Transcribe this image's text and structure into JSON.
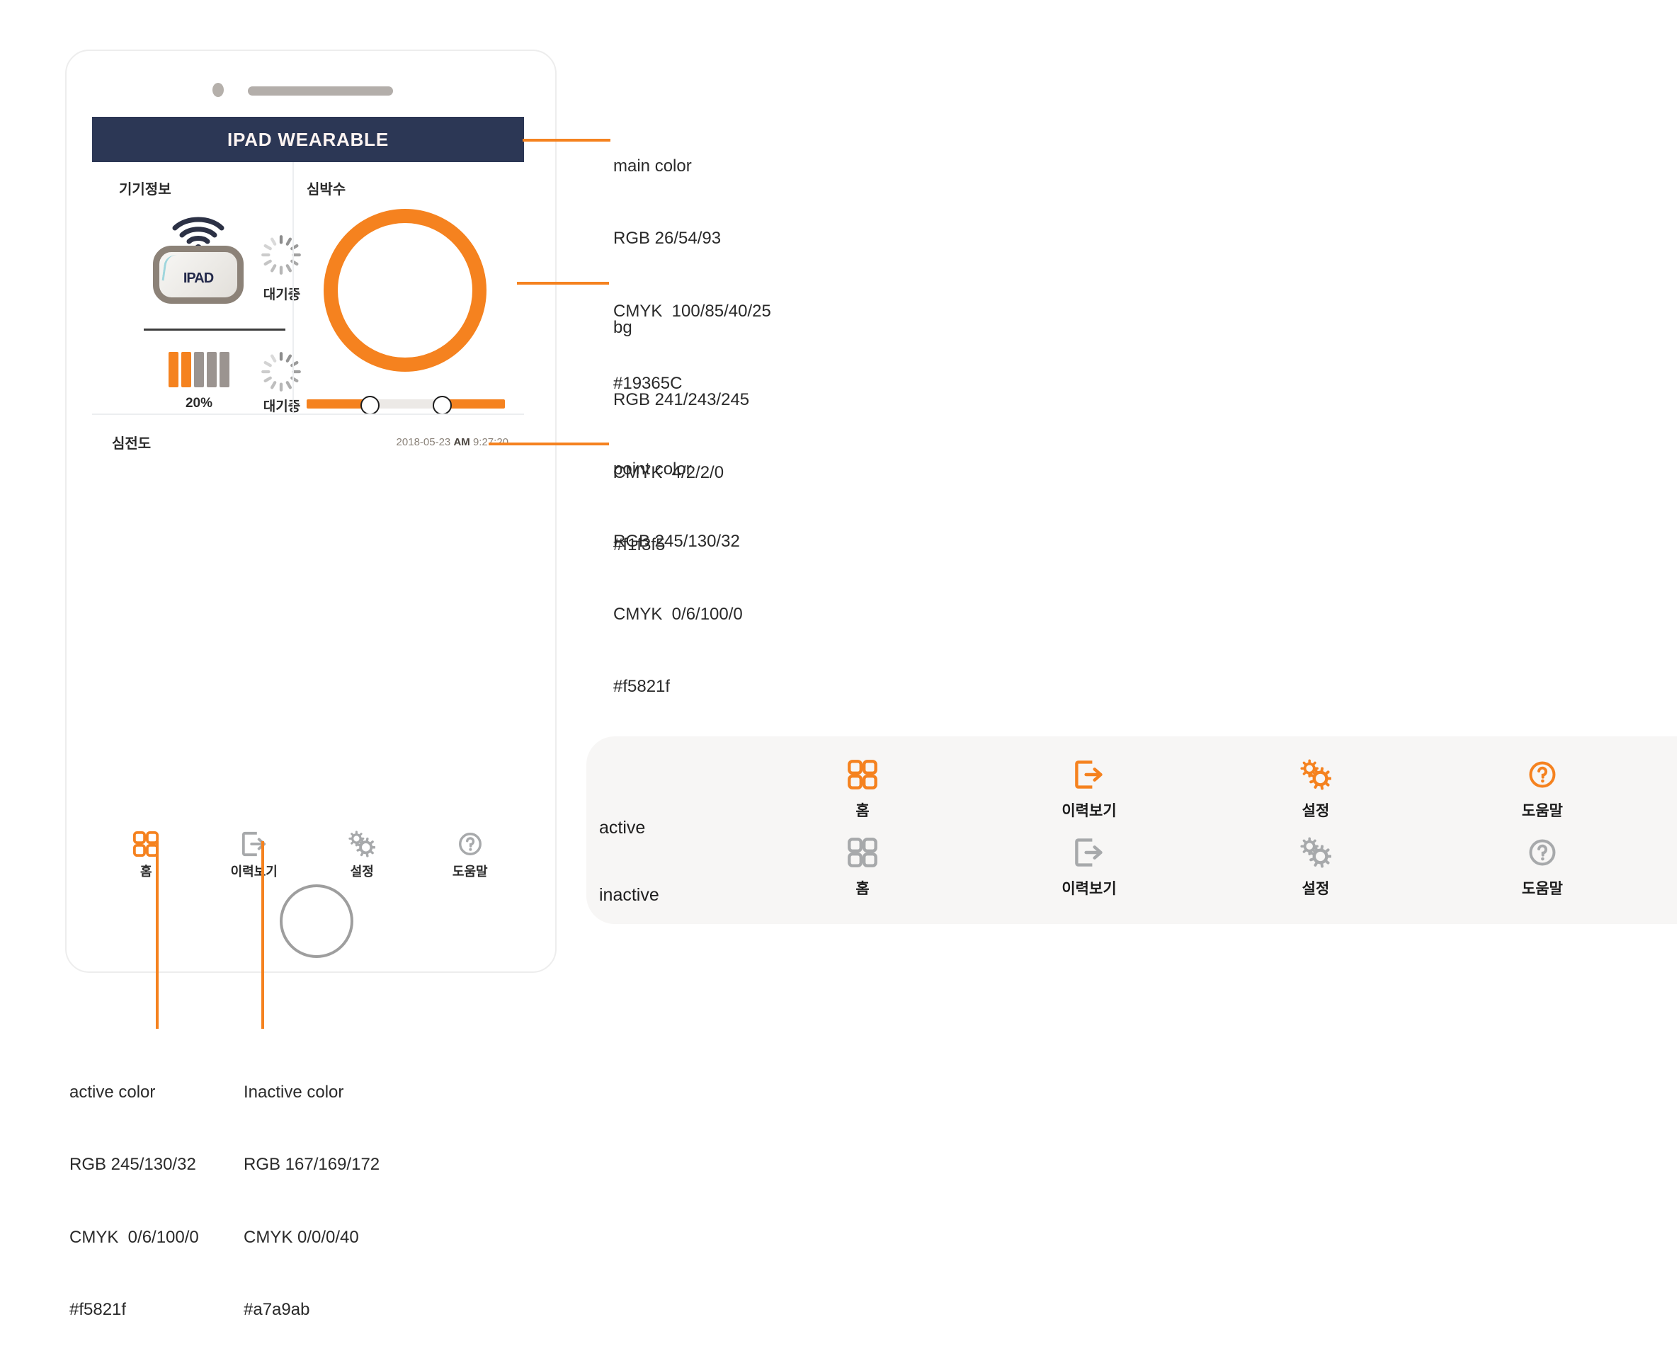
{
  "device": {
    "screen_title": "IPAD WEARABLE",
    "cards": {
      "device_info": {
        "label": "기기정보",
        "chip_word": "IPAD",
        "connection_status": "대기중",
        "battery_percent": "20%",
        "battery_status": "대기중",
        "battery_bars_filled": 2,
        "battery_bars_total": 5
      },
      "heart_rate": {
        "label": "심박수"
      }
    },
    "ecg": {
      "label": "심전도",
      "date": "2018-05-23",
      "meridiem": "AM",
      "time": "9:27:20"
    },
    "tabs": [
      {
        "id": "home",
        "icon": "grid-icon",
        "label": "홈",
        "state": "active"
      },
      {
        "id": "history",
        "icon": "export-icon",
        "label": "이력보기",
        "state": "inactive"
      },
      {
        "id": "settings",
        "icon": "gears-icon",
        "label": "설정",
        "state": "inactive"
      },
      {
        "id": "help",
        "icon": "question-icon",
        "label": "도움말",
        "state": "inactive"
      }
    ]
  },
  "annotations": [
    {
      "id": "main-color",
      "name": "main color",
      "rgb": "RGB 26/54/93",
      "cmyk": "CMYK  100/85/40/25",
      "hex": "#19365C"
    },
    {
      "id": "bg-color",
      "name": "bg",
      "rgb": "RGB 241/243/245",
      "cmyk": "CMYK  4/2/2/0",
      "hex": "#f1f3f5"
    },
    {
      "id": "point-color",
      "name": "point color",
      "rgb": "RGB 245/130/32",
      "cmyk": "CMYK  0/6/100/0",
      "hex": "#f5821f"
    },
    {
      "id": "active-color",
      "name": "active color",
      "rgb": "RGB 245/130/32",
      "cmyk": "CMYK  0/6/100/0",
      "hex": "#f5821f"
    },
    {
      "id": "inactive-color",
      "name": "Inactive color",
      "rgb": "RGB 167/169/172",
      "cmyk": "CMYK 0/0/0/40",
      "hex": "#a7a9ab"
    }
  ],
  "legend": {
    "row_active": "active",
    "row_inactive": "inactive",
    "items": [
      {
        "icon": "grid-icon",
        "label": "홈"
      },
      {
        "icon": "export-icon",
        "label": "이력보기"
      },
      {
        "icon": "gears-icon",
        "label": "설정"
      },
      {
        "icon": "question-icon",
        "label": "도움말"
      }
    ]
  },
  "colors": {
    "main": "#2c3755",
    "point": "#f5821f",
    "active": "#f5821f",
    "inactive": "#a7a9ab",
    "bg": "#f1f3f5"
  }
}
